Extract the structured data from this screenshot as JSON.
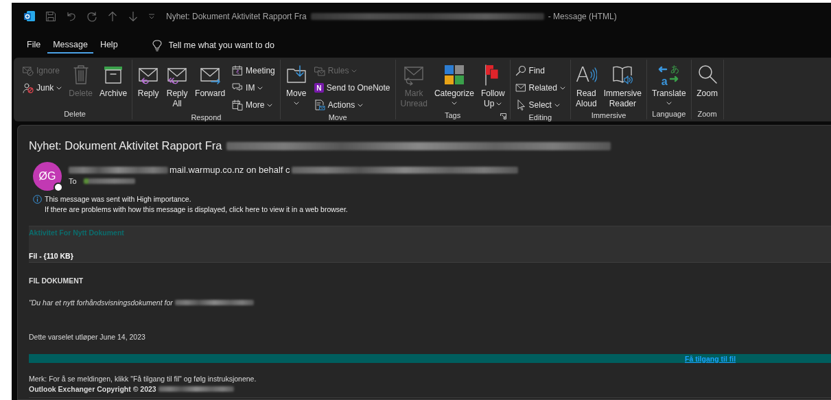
{
  "window": {
    "title": "Nyhet: Dokument Aktivitet Rapport Fra",
    "title_suffix": "- Message (HTML)"
  },
  "tabs": [
    {
      "label": "File",
      "selected": false
    },
    {
      "label": "Message",
      "selected": true
    },
    {
      "label": "Help",
      "selected": false
    }
  ],
  "tell_me": {
    "placeholder": "Tell me what you want to do"
  },
  "ribbon": [
    {
      "label": "Delete",
      "launcher": false,
      "items": [
        {
          "kind": "stack",
          "items": [
            {
              "label": "Ignore",
              "disabled": true,
              "dropdown": false
            },
            {
              "label": "Junk",
              "disabled": false,
              "dropdown": true
            }
          ]
        },
        {
          "kind": "large",
          "label": "Delete",
          "disabled": true
        },
        {
          "kind": "large",
          "label": "Archive",
          "disabled": false
        }
      ]
    },
    {
      "label": "Respond",
      "launcher": false,
      "items": [
        {
          "kind": "large",
          "label": "Reply",
          "disabled": false
        },
        {
          "kind": "large",
          "label": "Reply All",
          "disabled": false
        },
        {
          "kind": "large",
          "label": "Forward",
          "disabled": false
        },
        {
          "kind": "stack",
          "items": [
            {
              "label": "Meeting",
              "disabled": false,
              "dropdown": false
            },
            {
              "label": "IM",
              "disabled": false,
              "dropdown": true
            },
            {
              "label": "More",
              "disabled": false,
              "dropdown": true
            }
          ]
        }
      ]
    },
    {
      "label": "Move",
      "launcher": false,
      "items": [
        {
          "kind": "split",
          "label": "Move",
          "disabled": false
        },
        {
          "kind": "stack",
          "items": [
            {
              "label": "Rules",
              "disabled": true,
              "dropdown": true
            },
            {
              "label": "Send to OneNote",
              "disabled": false,
              "dropdown": false,
              "glyph": "N"
            },
            {
              "label": "Actions",
              "disabled": false,
              "dropdown": true
            }
          ]
        }
      ]
    },
    {
      "label": "Tags",
      "launcher": true,
      "items": [
        {
          "kind": "large",
          "label": "Mark Unread",
          "disabled": true
        },
        {
          "kind": "split",
          "label": "Categorize",
          "disabled": false
        },
        {
          "kind": "large",
          "label": "Follow Up",
          "disabled": false,
          "dropdown": true
        }
      ]
    },
    {
      "label": "Editing",
      "launcher": false,
      "items": [
        {
          "kind": "stack",
          "items": [
            {
              "label": "Find",
              "disabled": false,
              "dropdown": false
            },
            {
              "label": "Related",
              "disabled": false,
              "dropdown": true
            },
            {
              "label": "Select",
              "disabled": false,
              "dropdown": true
            }
          ]
        }
      ]
    },
    {
      "label": "Immersive",
      "launcher": false,
      "items": [
        {
          "kind": "large",
          "label": "Read Aloud",
          "disabled": false,
          "glyph": "A"
        },
        {
          "kind": "large",
          "label": "Immersive Reader",
          "disabled": false
        }
      ]
    },
    {
      "label": "Language",
      "launcher": false,
      "items": [
        {
          "kind": "split",
          "label": "Translate",
          "disabled": false,
          "glyphs": [
            "あ",
            "a"
          ]
        }
      ]
    },
    {
      "label": "Zoom",
      "launcher": false,
      "items": [
        {
          "kind": "large",
          "label": "Zoom",
          "disabled": false
        }
      ]
    }
  ],
  "message": {
    "subject": "Nyhet: Dokument Aktivitet Rapport Fra",
    "avatar": {
      "initials": "ØG",
      "color": "#c239b3"
    },
    "sender": "mail.warmup.co.nz on behalf c",
    "to_label": "To",
    "notices": [
      "This message was sent with High importance.",
      "If there are problems with how this message is displayed, click here to view it in a web browser."
    ]
  },
  "body": {
    "heading": "Aktivitet For Nytt Dokument",
    "file": "Fil - {110 KB}",
    "section": "FIL DOKUMENT",
    "intro": "\"Du har et nytt forhåndsvisningsdokument for",
    "expiry": "Dette varselet utløper June 14, 2023",
    "link": "Få tilgang til fil",
    "note": "Merk: For å se meldingen, klikk \"Få tilgang til fil\" og følg instruksjonene.",
    "footer": "Outlook Exchanger Copyright © 2023"
  }
}
